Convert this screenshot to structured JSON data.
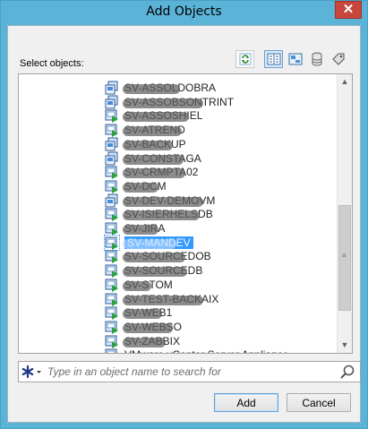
{
  "window": {
    "title": "Add Objects",
    "close_glyph": "✕"
  },
  "select_label": "Select objects:",
  "toolbar": {
    "buttons": [
      {
        "icon": "refresh-icon"
      },
      {
        "icon": "details-view-icon",
        "active": true
      },
      {
        "icon": "tile-view-icon"
      },
      {
        "icon": "database-icon"
      },
      {
        "icon": "tag-icon"
      }
    ]
  },
  "list": {
    "items": [
      {
        "label": "SV-ASSOLDOBRA",
        "icon": "server-group-icon",
        "redacted": true
      },
      {
        "label": "SV-ASSOBSONTRINT",
        "icon": "server-group-icon",
        "redacted": true
      },
      {
        "label": "SV-ASSOSHIEL",
        "icon": "vm-icon",
        "redacted": true
      },
      {
        "label": "SV-ATREND",
        "icon": "vm-icon",
        "redacted": true
      },
      {
        "label": "SV-BACKUP",
        "icon": "server-group-icon",
        "redacted": true
      },
      {
        "label": "SV-CONSTAGA",
        "icon": "server-group-icon",
        "redacted": true
      },
      {
        "label": "SV-CRMPTA02",
        "icon": "vm-icon",
        "redacted": true
      },
      {
        "label": "SV-DCM",
        "icon": "vm-icon",
        "redacted": true
      },
      {
        "label": "SV-DEV-DEMOVM",
        "icon": "server-group-icon",
        "redacted": true
      },
      {
        "label": "SV-ISIERHELSDB",
        "icon": "vm-icon",
        "redacted": true
      },
      {
        "label": "SV-JIRA",
        "icon": "vm-icon",
        "redacted": true
      },
      {
        "label": "SV-MANDEV",
        "icon": "vm-icon",
        "redacted": true,
        "selected": true
      },
      {
        "label": "SV-SOURCEDOB",
        "icon": "vm-icon",
        "redacted": true
      },
      {
        "label": "SV-SOURCEDB",
        "icon": "vm-icon",
        "redacted": true
      },
      {
        "label": "SV-STOM",
        "icon": "vm-icon",
        "redacted": true
      },
      {
        "label": "SV-TEST-BACKAIX",
        "icon": "vm-icon",
        "redacted": true
      },
      {
        "label": "SV-WEB1",
        "icon": "vm-icon",
        "redacted": true
      },
      {
        "label": "SV-WEBSO",
        "icon": "vm-icon",
        "redacted": true
      },
      {
        "label": "SV-ZABBIX",
        "icon": "vm-icon",
        "redacted": true
      },
      {
        "label": "VMware vCenter Server Appliance",
        "icon": "vm-icon",
        "redacted": false
      }
    ]
  },
  "search": {
    "scope_icon": "asterisk-scope-icon",
    "placeholder": "Type in an object name to search for",
    "value": ""
  },
  "buttons": {
    "add_label": "Add",
    "cancel_label": "Cancel"
  },
  "colors": {
    "chrome": "#5bb4d8",
    "selection": "#3399ff",
    "close": "#c9463d"
  }
}
